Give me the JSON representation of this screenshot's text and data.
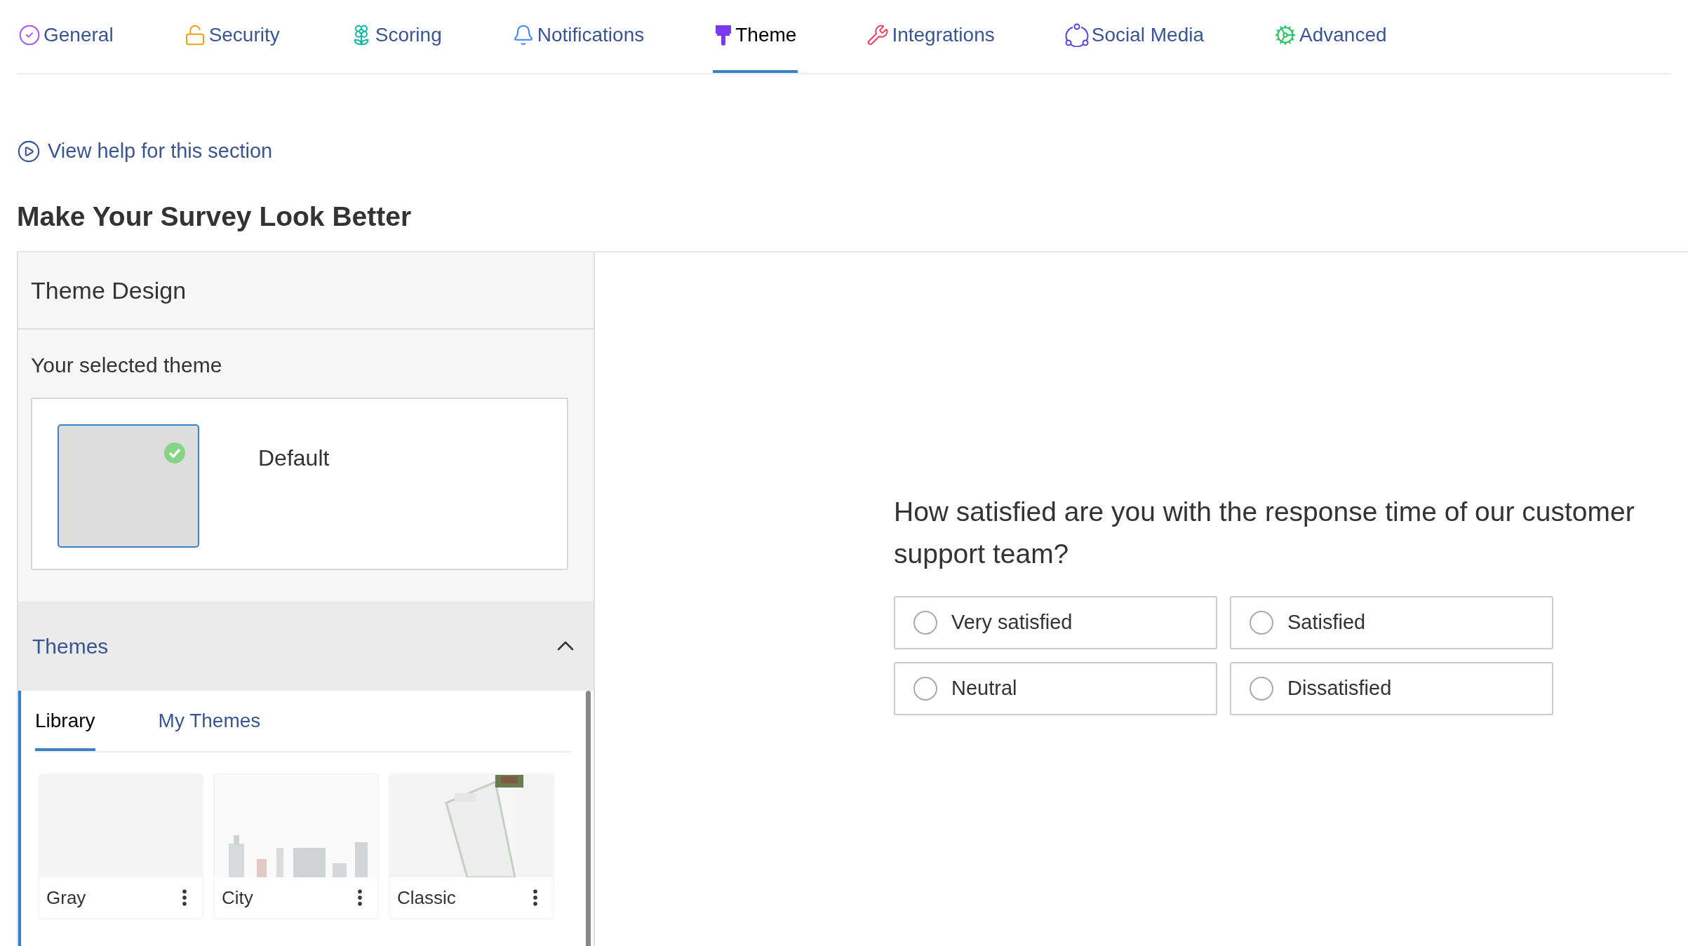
{
  "tabs": [
    {
      "label": "General",
      "selected": false
    },
    {
      "label": "Security",
      "selected": false
    },
    {
      "label": "Scoring",
      "selected": false
    },
    {
      "label": "Notifications",
      "selected": false
    },
    {
      "label": "Theme",
      "selected": true
    },
    {
      "label": "Integrations",
      "selected": false
    },
    {
      "label": "Social Media",
      "selected": false
    },
    {
      "label": "Advanced",
      "selected": false
    }
  ],
  "help_link": "View help for this section",
  "heading": "Make Your Survey Look Better",
  "panel": {
    "title": "Theme Design",
    "selected_label": "Your selected theme",
    "selected_theme": {
      "name": "Default",
      "checked": true
    },
    "themes_section": {
      "title": "Themes",
      "expanded": true,
      "subtabs": [
        {
          "label": "Library",
          "selected": true
        },
        {
          "label": "My Themes",
          "selected": false
        }
      ],
      "cards": [
        {
          "name": "Gray",
          "kind": "plain"
        },
        {
          "name": "City",
          "kind": "picture"
        },
        {
          "name": "Classic",
          "kind": "picture"
        }
      ]
    }
  },
  "preview": {
    "question": "How satisfied are you with the response time of our customer support team?",
    "options": [
      {
        "label": "Very satisfied",
        "selected": false
      },
      {
        "label": "Satisfied",
        "selected": false
      },
      {
        "label": "Neutral",
        "selected": false
      },
      {
        "label": "Dissatisfied",
        "selected": false
      }
    ]
  }
}
